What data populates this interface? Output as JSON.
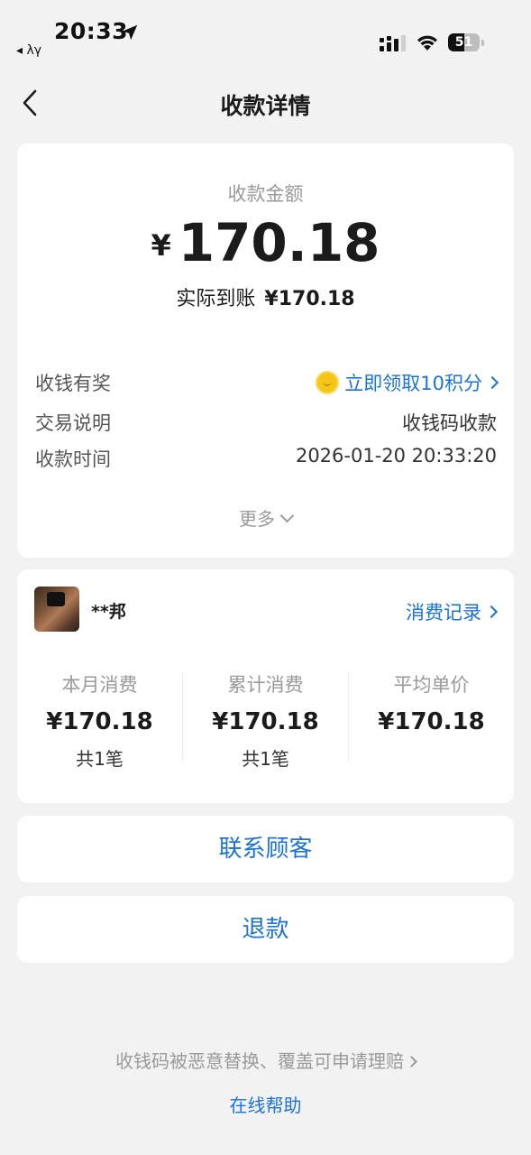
{
  "status_bar": {
    "time": "20:33",
    "back_app": "◂ λγ",
    "battery": "51",
    "battery_level": 0.51,
    "icons": [
      "location-arrow-icon",
      "signal-icon",
      "wifi-icon",
      "battery-icon"
    ]
  },
  "nav": {
    "title": "收款详情",
    "back_icon": "chevron-left-icon"
  },
  "payment": {
    "amount_label": "收款金额",
    "currency": "¥",
    "amount": "170.18",
    "actual_label": "实际到账",
    "actual_value": "¥170.18",
    "rows": [
      {
        "label": "收钱有奖",
        "value": "立即领取10积分"
      },
      {
        "label": "交易说明",
        "value": "收钱码收款"
      },
      {
        "label": "收款时间",
        "value": "2026-01-20 20:33:20"
      }
    ],
    "more": "更多"
  },
  "customer": {
    "name": "**邦",
    "record_link": "消费记录",
    "stats": [
      {
        "label": "本月消费",
        "value": "¥170.18",
        "count": "共1笔"
      },
      {
        "label": "累计消费",
        "value": "¥170.18",
        "count": "共1笔"
      },
      {
        "label": "平均单价",
        "value": "¥170.18",
        "count": ""
      }
    ]
  },
  "actions": {
    "contact": "联系顾客",
    "refund": "退款"
  },
  "footer": {
    "claim": "收钱码被恶意替换、覆盖可申请理赔",
    "help": "在线帮助"
  },
  "colors": {
    "accent": "#1a73d9",
    "background": "#f2f2f2",
    "card": "#ffffff",
    "muted": "#9a9a9a"
  }
}
